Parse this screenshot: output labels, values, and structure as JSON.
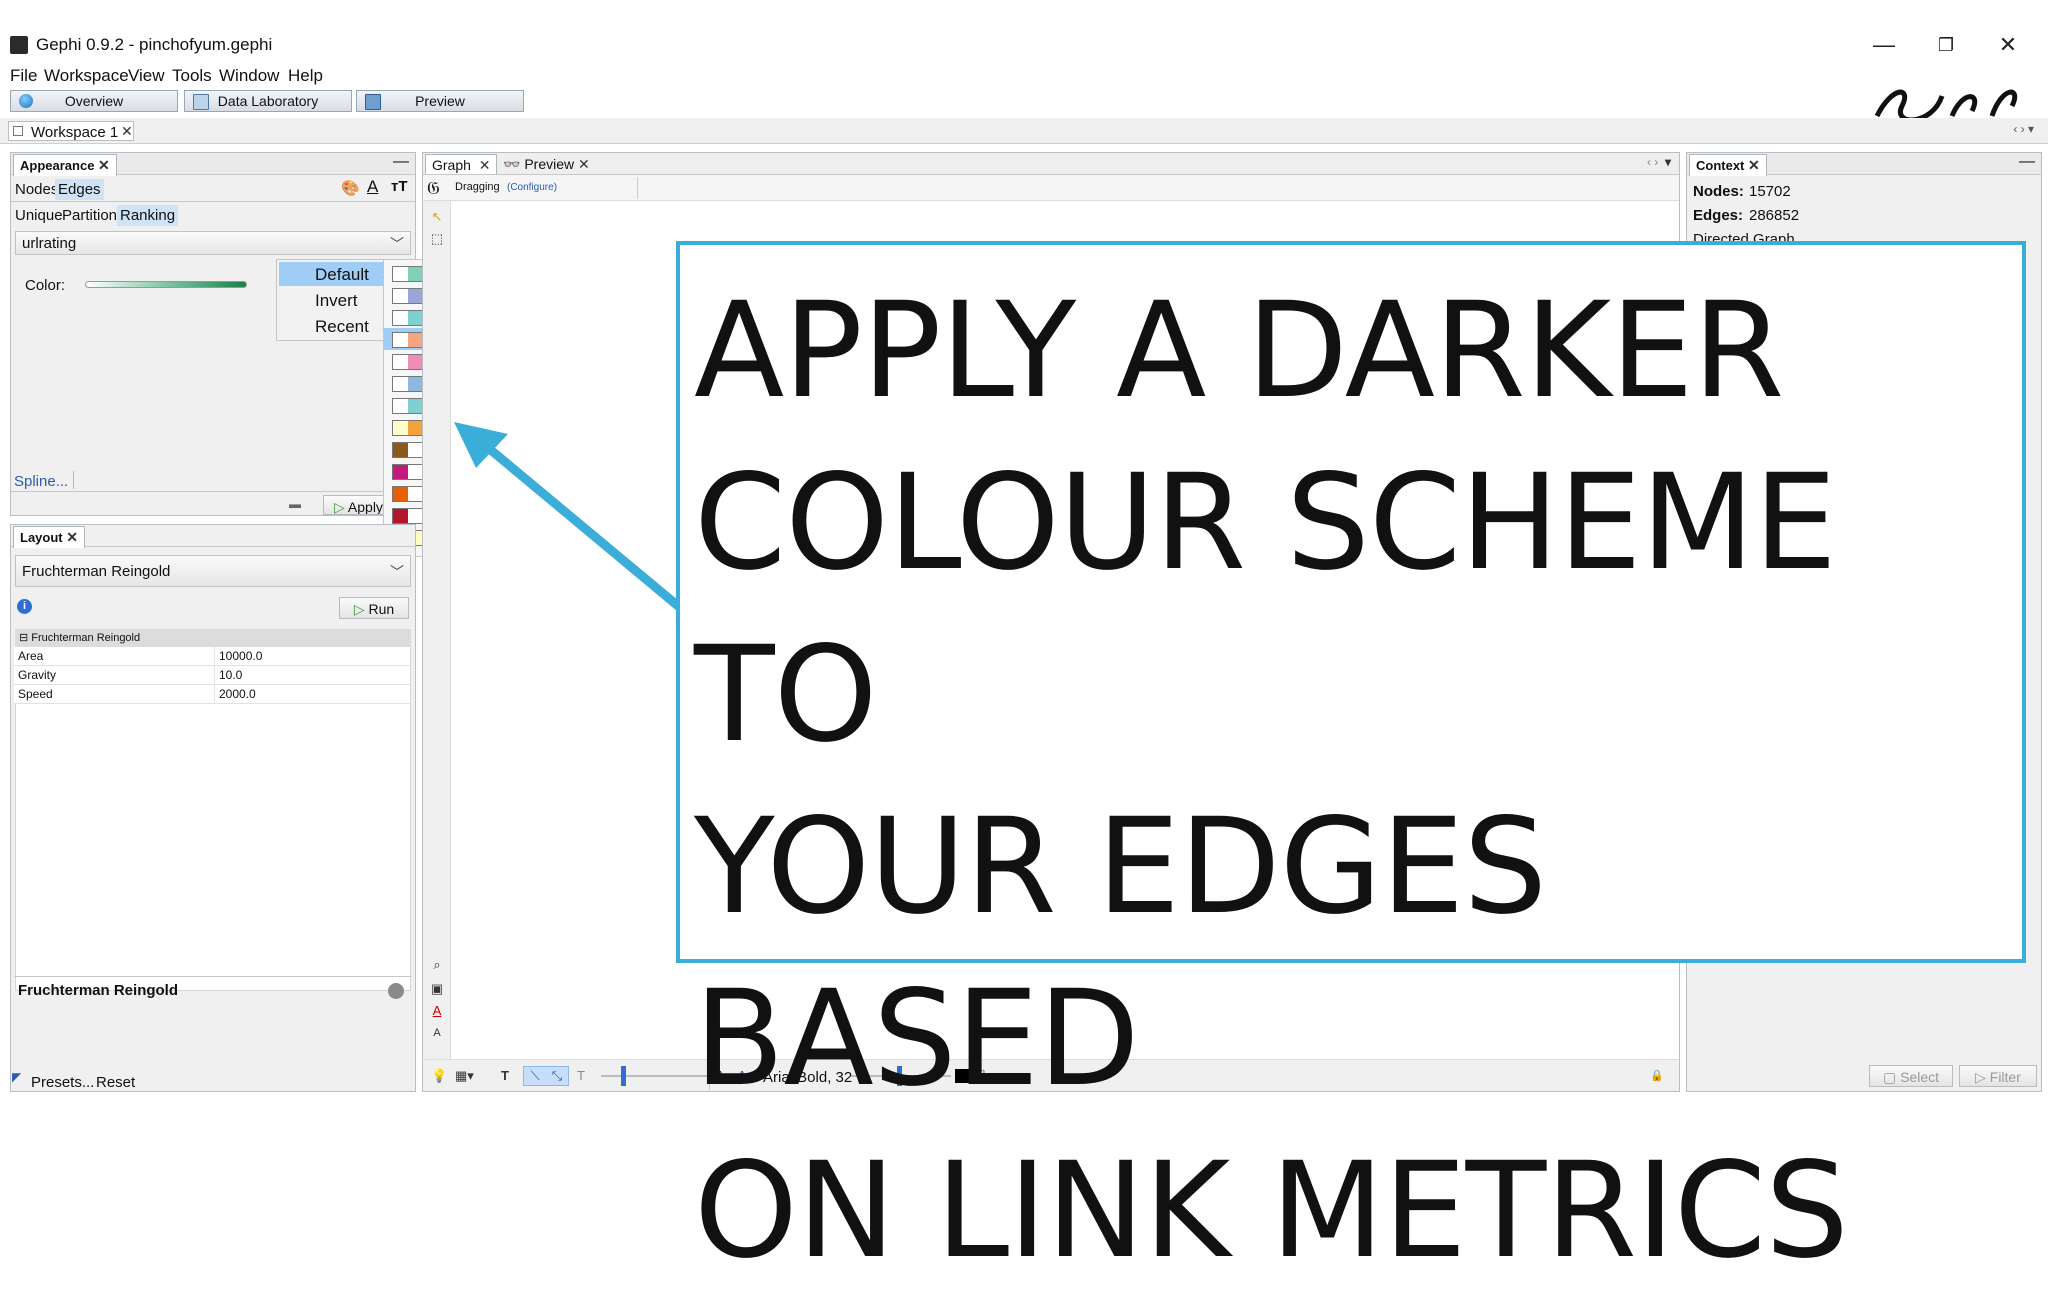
{
  "window": {
    "title": "Gephi 0.9.2 - pinchofyum.gephi",
    "minimize": "—",
    "restore": "❐",
    "close": "✕"
  },
  "menu": [
    "File",
    "Workspace",
    "View",
    "Tools",
    "Window",
    "Help"
  ],
  "main_tabs": [
    {
      "label": "Overview"
    },
    {
      "label": "Data Laboratory"
    },
    {
      "label": "Preview"
    }
  ],
  "workspace": {
    "tab": "Workspace 1"
  },
  "appearance": {
    "title": "Appearance",
    "target_tabs": [
      "Nodes",
      "Edges"
    ],
    "mode_tabs": [
      "Unique",
      "Partition",
      "Ranking"
    ],
    "attribute": "urlrating",
    "color_label": "Color:",
    "spline_link": "Spline...",
    "apply_label": "Apply"
  },
  "palette_menu": {
    "items": [
      "Default",
      "Invert",
      "Recent"
    ]
  },
  "palettes": [
    [
      "#ffffff",
      "#7fd1b9",
      "#1a7f4a"
    ],
    [
      "#ffffff",
      "#9ba7d6",
      "#8a1f8a"
    ],
    [
      "#ffffff",
      "#7fd1d1",
      "#1f6fb0"
    ],
    [
      "#ffffff",
      "#f4a582",
      "#b2182b"
    ],
    [
      "#ffffff",
      "#f08cb8",
      "#8a1f8a"
    ],
    [
      "#ffffff",
      "#8fb8e0",
      "#1f3a8a"
    ],
    [
      "#ffffff",
      "#7fd1d1",
      "#1f3a8a"
    ],
    [
      "#ffffcc",
      "#f4a23a",
      "#b2441f"
    ],
    [
      "#8a5a1a",
      "#ffffff",
      "#1a7f6a"
    ],
    [
      "#c51b7d",
      "#ffffff",
      "#4d9221"
    ],
    [
      "#e66101",
      "#ffffff",
      "#5e3c99"
    ],
    [
      "#b2182b",
      "#ffffff",
      "#4d4d4d"
    ],
    [
      "#d7191c",
      "#ffffbf",
      "#2c7bb6"
    ]
  ],
  "layout": {
    "title": "Layout",
    "algorithm": "Fruchterman Reingold",
    "run_label": "Run",
    "section": "Fruchterman Reingold",
    "properties": [
      {
        "name": "Area",
        "value": "10000.0"
      },
      {
        "name": "Gravity",
        "value": "10.0"
      },
      {
        "name": "Speed",
        "value": "2000.0"
      }
    ],
    "description_title": "Fruchterman Reingold",
    "presets_label": "Presets...",
    "reset_label": "Reset"
  },
  "graph": {
    "tabs": [
      "Graph",
      "Preview"
    ],
    "mode": "Dragging",
    "configure": "(Configure)",
    "font_label": "Arial Bold, 32"
  },
  "context": {
    "title": "Context",
    "nodes_label": "Nodes:",
    "nodes_value": "15702",
    "edges_label": "Edges:",
    "edges_value": "286852",
    "graph_type": "Directed Graph",
    "select_label": "Select",
    "filter_label": "Filter"
  },
  "callout": {
    "lines": [
      "APPLY A DARKER",
      "COLOUR SCHEME TO",
      "YOUR EDGES BASED",
      "ON LINK METRICS"
    ],
    "border_color": "#3aaed8",
    "arrow_color": "#3aaed8"
  }
}
